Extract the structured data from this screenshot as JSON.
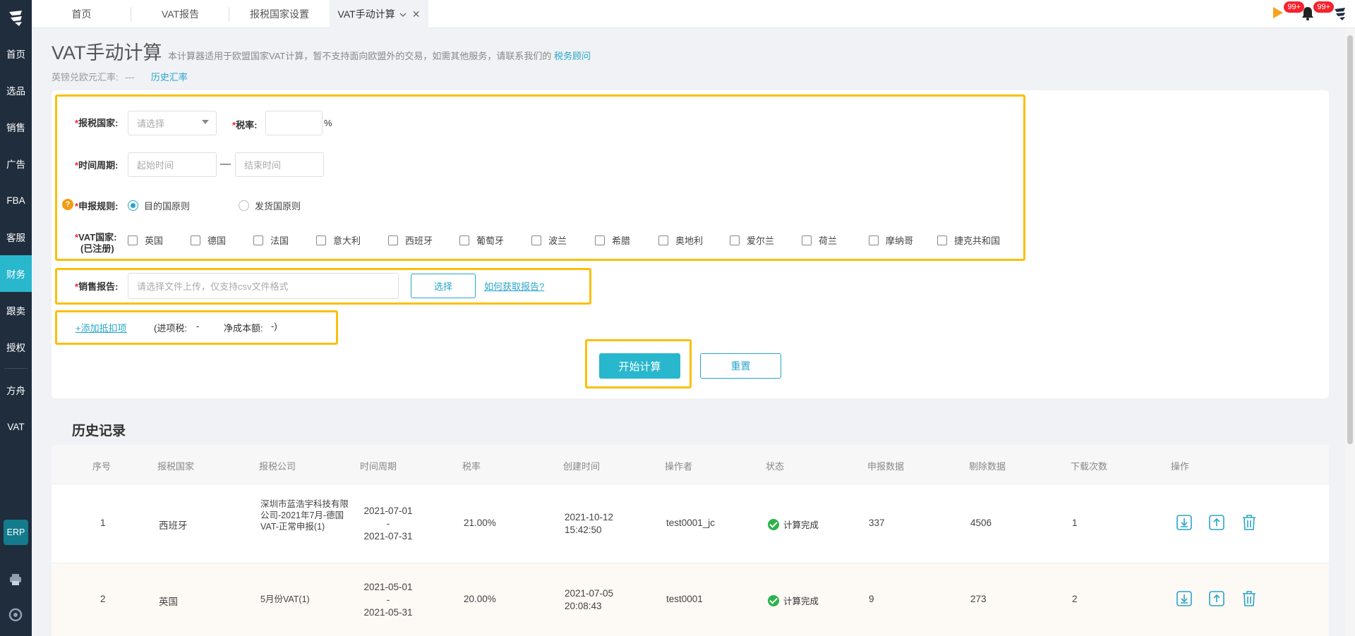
{
  "sidebar": {
    "items": [
      {
        "label": "首页"
      },
      {
        "label": "选品"
      },
      {
        "label": "销售"
      },
      {
        "label": "广告"
      },
      {
        "label": "FBA"
      },
      {
        "label": "客服"
      },
      {
        "label": "财务",
        "active": true
      },
      {
        "label": "跟卖"
      },
      {
        "label": "授权"
      }
    ],
    "items2": [
      {
        "label": "方舟"
      },
      {
        "label": "VAT"
      }
    ],
    "erp_label": "ERP"
  },
  "tabs": [
    {
      "label": "首页"
    },
    {
      "label": "VAT报告"
    },
    {
      "label": "报税国家设置"
    },
    {
      "label": "VAT手动计算",
      "active": true
    }
  ],
  "notifications": {
    "flag_badge": "99+",
    "bell_badge": "99+"
  },
  "page": {
    "title": "VAT手动计算",
    "desc": "本计算器适用于欧盟国家VAT计算，暂不支持面向欧盟外的交易，如需其他服务，请联系我们的",
    "desc_link": "税务顾问",
    "rate_label": "英镑兑欧元汇率:",
    "rate_value": "---",
    "rate_link": "历史汇率"
  },
  "form": {
    "country_label": "报税国家:",
    "country_placeholder": "请选择",
    "tax_rate_label": "税率:",
    "percent": "%",
    "period_label": "时间周期:",
    "start_placeholder": "起始时间",
    "end_placeholder": "结束时间",
    "dash": "—",
    "rule_label": "申报规则:",
    "rule_options": [
      "目的国原则",
      "发货国原则"
    ],
    "rule_selected": "目的国原则",
    "vat_label": "VAT国家:",
    "vat_sublabel": "(已注册)",
    "vat_countries": [
      "英国",
      "德国",
      "法国",
      "意大利",
      "西班牙",
      "葡萄牙",
      "波兰",
      "希腊",
      "奥地利",
      "爱尔兰",
      "荷兰",
      "摩纳哥",
      "捷克共和国"
    ],
    "report_label": "销售报告:",
    "report_placeholder": "请选择文件上传，仅支持csv文件格式",
    "choose_button": "选择",
    "how_link": "如何获取报告?",
    "add_deduction": "+添加抵扣项",
    "input_tax": "(进项税:",
    "input_tax_value": "-",
    "net_cost": "净成本额:",
    "net_cost_value": "-)",
    "start_button": "开始计算",
    "reset_button": "重置"
  },
  "history": {
    "title": "历史记录",
    "columns": [
      "序号",
      "报税国家",
      "报税公司",
      "时间周期",
      "税率",
      "创建时间",
      "操作者",
      "状态",
      "申报数据",
      "剔除数据",
      "下载次数",
      "操作"
    ],
    "rows": [
      {
        "index": "1",
        "country": "西班牙",
        "company": "深圳市蓝浩宇科技有限公司-2021年7月-德国VAT-正常申报(1)",
        "period_start": "2021-07-01",
        "period_sep": "-",
        "period_end": "2021-07-31",
        "rate": "21.00%",
        "created_date": "2021-10-12",
        "created_time": "15:42:50",
        "operator": "test0001_jc",
        "status": "计算完成",
        "declared": "337",
        "removed": "4506",
        "downloads": "1"
      },
      {
        "index": "2",
        "country": "英国",
        "company": "5月份VAT(1)",
        "period_start": "2021-05-01",
        "period_sep": "-",
        "period_end": "2021-05-31",
        "rate": "20.00%",
        "created_date": "2021-07-05",
        "created_time": "20:08:43",
        "operator": "test0001",
        "status": "计算完成",
        "declared": "9",
        "removed": "273",
        "downloads": "2"
      }
    ]
  },
  "colors": {
    "accent": "#28b7cd",
    "highlight": "#fbbf0a",
    "sidebar": "#1f2d3d",
    "link": "#28a6c9"
  }
}
